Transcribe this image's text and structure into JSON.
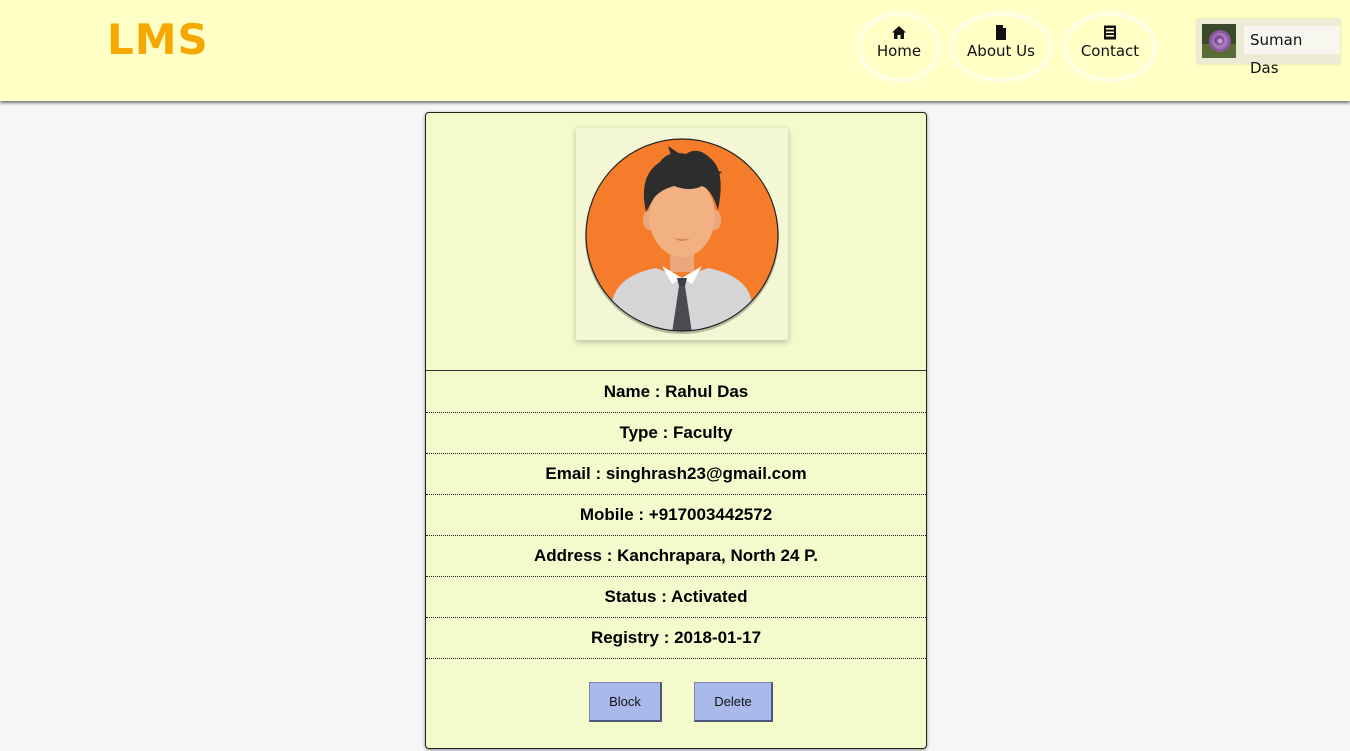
{
  "header": {
    "logo": "LMS",
    "nav": [
      {
        "label": "Home",
        "icon": "home-icon"
      },
      {
        "label": "About Us",
        "icon": "file-icon"
      },
      {
        "label": "Contact",
        "icon": "contact-card-icon"
      }
    ],
    "user": {
      "name": "Suman Das",
      "avatar_icon": "flower-avatar"
    }
  },
  "profile": {
    "photo_icon": "male-avatar-illustration",
    "rows": [
      {
        "text": "Name : Rahul Das"
      },
      {
        "text": "Type : Faculty"
      },
      {
        "text": "Email : singhrash23@gmail.com"
      },
      {
        "text": "Mobile : +917003442572"
      },
      {
        "text": "Address : Kanchrapara, North 24 P."
      },
      {
        "text": "Status : Activated"
      },
      {
        "text": "Registry : 2018-01-17"
      }
    ],
    "actions": {
      "block_label": "Block",
      "delete_label": "Delete"
    }
  },
  "colors": {
    "header_bg": "#ffffc6",
    "logo": "#f5a800",
    "card_bg": "#f4facc",
    "button_bg": "#a8b9ea",
    "avatar_circle": "#f57c2a"
  }
}
